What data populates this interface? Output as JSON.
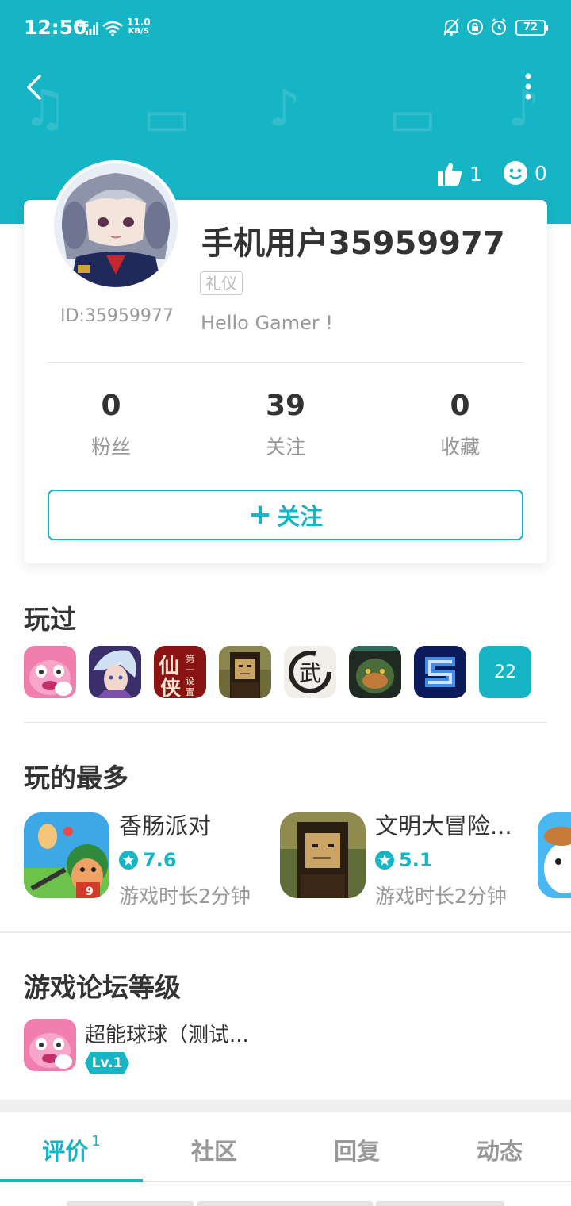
{
  "status_bar": {
    "time": "12:50",
    "network": "4G",
    "speed_value": "11.0",
    "speed_unit": "KB/S",
    "battery": "72"
  },
  "header": {
    "like_count": "1",
    "face_count": "0"
  },
  "profile": {
    "username": "手机用户35959977",
    "id_text": "ID:35959977",
    "tag": "礼仪",
    "bio": "Hello Gamer !",
    "stats": [
      {
        "value": "0",
        "label": "粉丝"
      },
      {
        "value": "39",
        "label": "关注"
      },
      {
        "value": "0",
        "label": "收藏"
      }
    ],
    "follow_plus": "+",
    "follow_label": "关注"
  },
  "played": {
    "title": "玩过",
    "games": [
      "pink-monster",
      "silver-hair-hero",
      "xianxia",
      "mona-lisa-pixel",
      "wu-calligraphy",
      "dark-ogre",
      "blue-s"
    ],
    "more_count": "22"
  },
  "most_played": {
    "title": "玩的最多",
    "items": [
      {
        "name": "香肠派对",
        "rating": "7.6",
        "time": "游戏时长2分钟"
      },
      {
        "name": "文明大冒险...",
        "rating": "5.1",
        "time": "游戏时长2分钟"
      }
    ]
  },
  "forum": {
    "title": "游戏论坛等级",
    "game_name": "超能球球（测试...",
    "level": "Lv.1"
  },
  "tabs": [
    {
      "label": "评价",
      "count": "1"
    },
    {
      "label": "社区"
    },
    {
      "label": "回复"
    },
    {
      "label": "动态"
    }
  ],
  "colors": {
    "accent": "#16b5c6",
    "text_primary": "#333333",
    "text_secondary": "#999999"
  }
}
